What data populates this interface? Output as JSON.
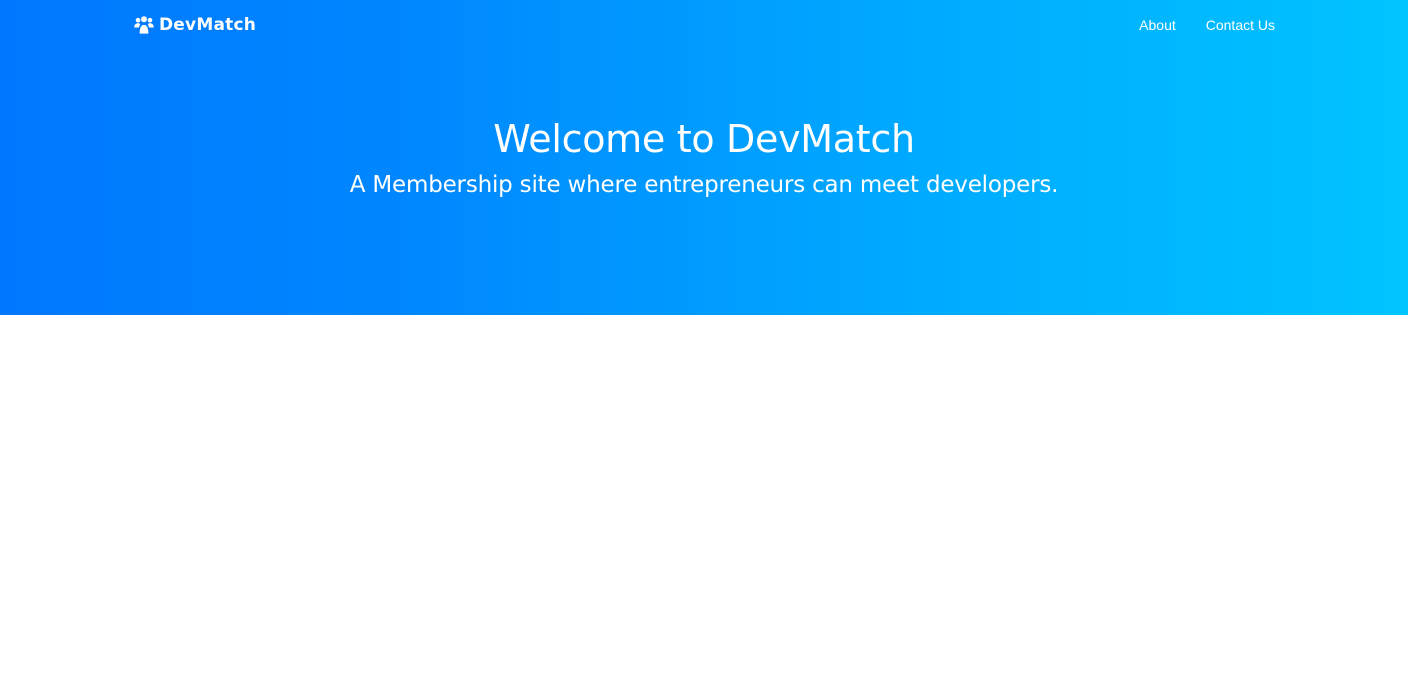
{
  "navbar": {
    "brand": {
      "icon": "users-icon",
      "label": "DevMatch"
    },
    "links": [
      {
        "label": "About"
      },
      {
        "label": "Contact Us"
      }
    ]
  },
  "hero": {
    "title": "Welcome to DevMatch",
    "subtitle": "A Membership site where entrepreneurs can meet developers."
  },
  "colors": {
    "gradient_start": "#0077ff",
    "gradient_end": "#00c4ff",
    "text": "#ffffff",
    "page_background": "#ffffff"
  }
}
